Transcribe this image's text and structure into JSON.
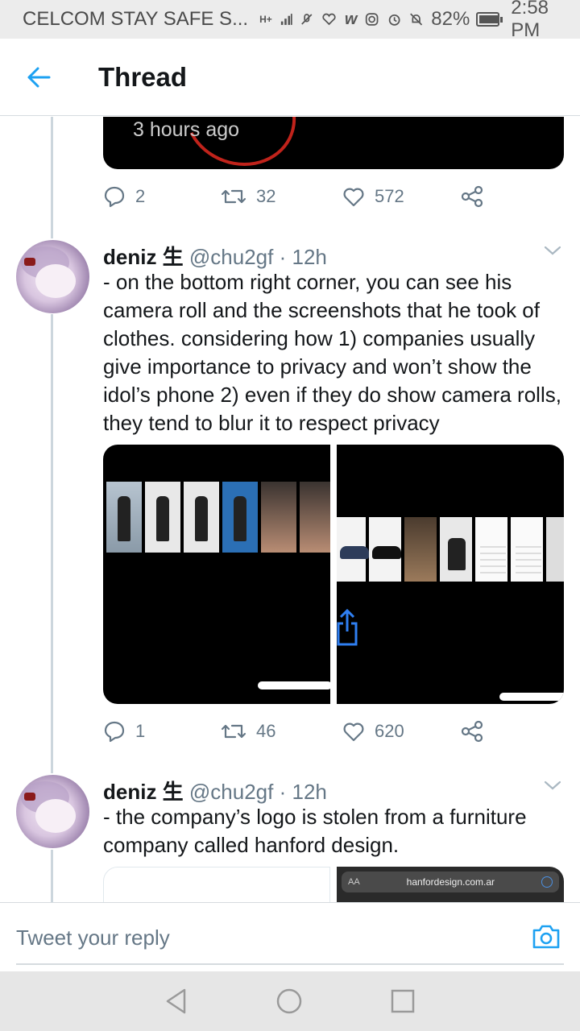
{
  "status_bar": {
    "carrier": "CELCOM STAY SAFE S...",
    "network": "H+",
    "battery_percent_label": "82%",
    "battery_level": 0.82,
    "time": "2:58 PM"
  },
  "header": {
    "title": "Thread"
  },
  "tweet0": {
    "timestamp_overlay": "3 hours ago",
    "replies": "2",
    "retweets": "32",
    "likes": "572"
  },
  "tweet1": {
    "name": "deniz 生",
    "handle": "@chu2gf",
    "time": "· 12h",
    "text": "- on the bottom right corner, you can see his camera roll and the screenshots that he took of clothes. considering how 1) companies usually give importance to privacy and won’t show the idol’s phone 2) even if they do show camera rolls, they tend to blur it to respect privacy",
    "replies": "1",
    "retweets": "46",
    "likes": "620"
  },
  "tweet2": {
    "name": "deniz 生",
    "handle": "@chu2gf",
    "time": "· 12h",
    "text": "- the company’s logo is stolen from a furniture company called hanford design.",
    "media_url_text": "hanfordesign.com.ar",
    "media_aa": "AA"
  },
  "reply_bar": {
    "placeholder": "Tweet your reply"
  },
  "colors": {
    "accent": "#1da1f2",
    "muted": "#657786",
    "status_bar_bg": "#ececec"
  }
}
